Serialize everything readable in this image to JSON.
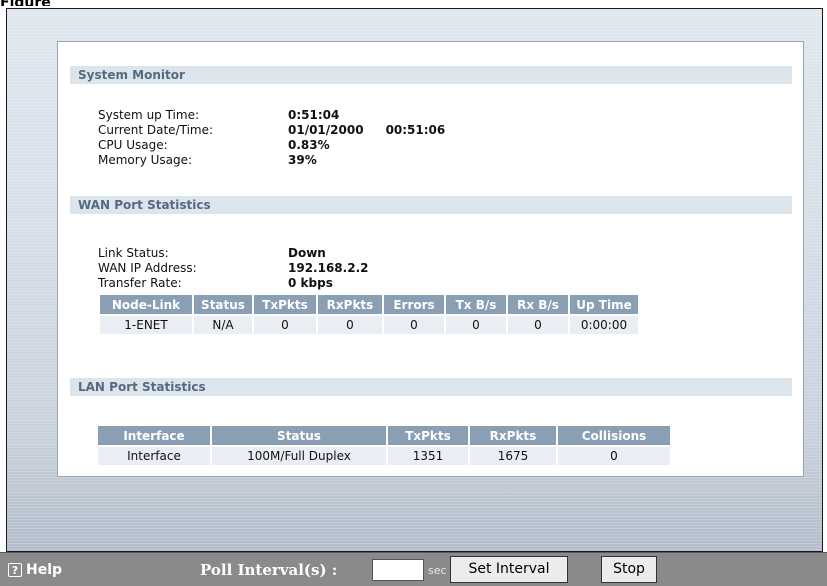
{
  "page_heading": "Figure",
  "system_monitor": {
    "title": "System Monitor",
    "rows": [
      {
        "label": "System up Time:",
        "value": "0:51:04",
        "value2": ""
      },
      {
        "label": "Current Date/Time:",
        "value": "01/01/2000",
        "value2": "00:51:06"
      },
      {
        "label": "CPU Usage:",
        "value": "0.83%",
        "value2": ""
      },
      {
        "label": "Memory Usage:",
        "value": "39%",
        "value2": ""
      }
    ]
  },
  "wan": {
    "title": "WAN Port Statistics",
    "rows": [
      {
        "label": "Link Status:",
        "value": "Down"
      },
      {
        "label": "WAN IP Address:",
        "value": "192.168.2.2"
      },
      {
        "label": "Transfer Rate:",
        "value": "0 kbps"
      }
    ],
    "table": {
      "headers": [
        "Node-Link",
        "Status",
        "TxPkts",
        "RxPkts",
        "Errors",
        "Tx B/s",
        "Rx B/s",
        "Up Time"
      ],
      "rows": [
        [
          "1-ENET",
          "N/A",
          "0",
          "0",
          "0",
          "0",
          "0",
          "0:00:00"
        ]
      ]
    }
  },
  "lan": {
    "title": "LAN Port Statistics",
    "table": {
      "headers": [
        "Interface",
        "Status",
        "TxPkts",
        "RxPkts",
        "Collisions"
      ],
      "rows": [
        [
          "Interface",
          "100M/Full Duplex",
          "1351",
          "1675",
          "0"
        ]
      ]
    }
  },
  "footer": {
    "help_label": "Help",
    "help_icon_glyph": "?",
    "poll_label": "Poll Interval(s) :",
    "poll_value": "",
    "unit_label": "sec",
    "set_interval_label": "Set Interval",
    "stop_label": "Stop"
  }
}
